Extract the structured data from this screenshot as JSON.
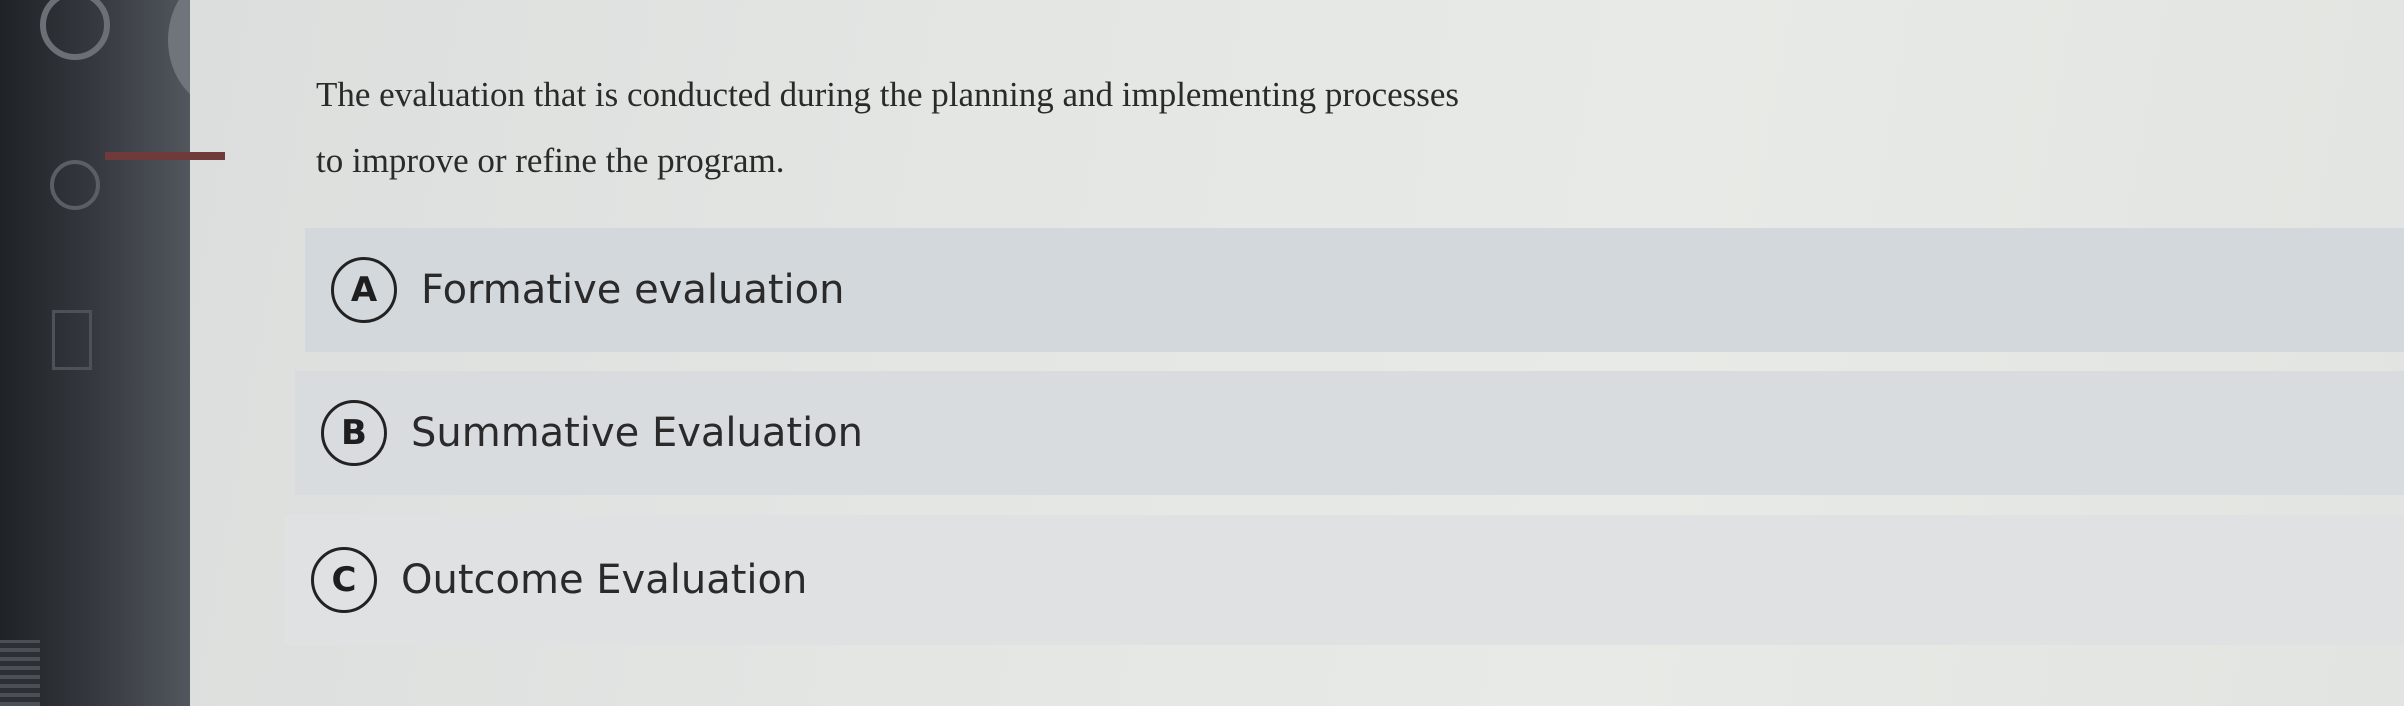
{
  "question": {
    "line1": "The evaluation that is conducted during the planning and implementing processes",
    "line2": "to improve or refine the program."
  },
  "options": [
    {
      "letter": "A",
      "label": "Formative evaluation"
    },
    {
      "letter": "B",
      "label": "Summative Evaluation"
    },
    {
      "letter": "C",
      "label": "Outcome Evaluation"
    }
  ],
  "colors": {
    "panel": "#e4e6e4",
    "option_bg": "#d6dade",
    "text": "#2a2a2a",
    "rail": "#34383e"
  }
}
